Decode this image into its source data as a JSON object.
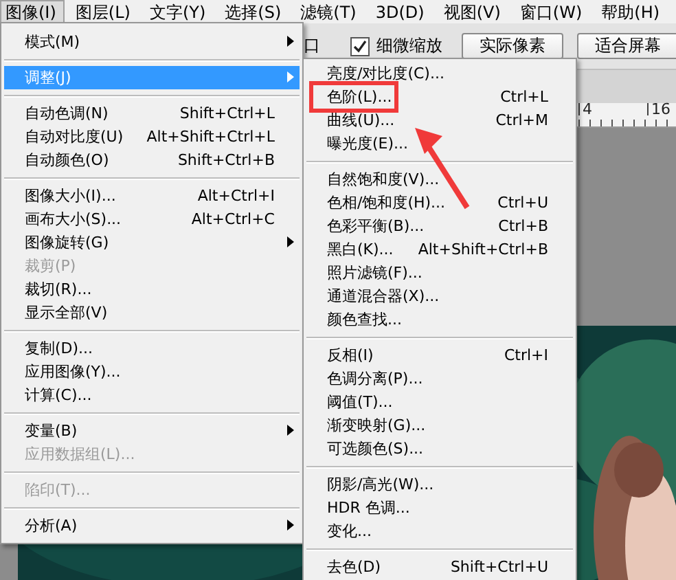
{
  "menu_bar": [
    {
      "label": "图像(I)",
      "selected": true
    },
    {
      "label": "图层(L)",
      "selected": false
    },
    {
      "label": "文字(Y)",
      "selected": false
    },
    {
      "label": "选择(S)",
      "selected": false
    },
    {
      "label": "滤镜(T)",
      "selected": false
    },
    {
      "label": "3D(D)",
      "selected": false
    },
    {
      "label": "视图(V)",
      "selected": false
    },
    {
      "label": "窗口(W)",
      "selected": false
    },
    {
      "label": "帮助(H)",
      "selected": false
    }
  ],
  "options_bar": {
    "cut_label": "口",
    "checkbox": {
      "label": "细微缩放",
      "checked": true
    },
    "buttons": [
      "实际像素",
      "适合屏幕"
    ]
  },
  "ruler": [
    "4",
    "16"
  ],
  "image_menu": {
    "items": [
      {
        "kind": "submenu",
        "label": "模式(M)",
        "selected": false,
        "disabled": false
      },
      {
        "kind": "separator"
      },
      {
        "kind": "submenu",
        "label": "调整(J)",
        "selected": true,
        "disabled": false
      },
      {
        "kind": "separator"
      },
      {
        "kind": "item",
        "label": "自动色调(N)",
        "shortcut": "Shift+Ctrl+L",
        "selected": false,
        "disabled": false
      },
      {
        "kind": "item",
        "label": "自动对比度(U)",
        "shortcut": "Alt+Shift+Ctrl+L",
        "selected": false,
        "disabled": false
      },
      {
        "kind": "item",
        "label": "自动颜色(O)",
        "shortcut": "Shift+Ctrl+B",
        "selected": false,
        "disabled": false
      },
      {
        "kind": "separator"
      },
      {
        "kind": "item",
        "label": "图像大小(I)...",
        "shortcut": "Alt+Ctrl+I",
        "selected": false,
        "disabled": false
      },
      {
        "kind": "item",
        "label": "画布大小(S)...",
        "shortcut": "Alt+Ctrl+C",
        "selected": false,
        "disabled": false
      },
      {
        "kind": "submenu",
        "label": "图像旋转(G)",
        "selected": false,
        "disabled": false
      },
      {
        "kind": "item",
        "label": "裁剪(P)",
        "selected": false,
        "disabled": true
      },
      {
        "kind": "item",
        "label": "裁切(R)...",
        "selected": false,
        "disabled": false
      },
      {
        "kind": "item",
        "label": "显示全部(V)",
        "selected": false,
        "disabled": false
      },
      {
        "kind": "separator"
      },
      {
        "kind": "item",
        "label": "复制(D)...",
        "selected": false,
        "disabled": false
      },
      {
        "kind": "item",
        "label": "应用图像(Y)...",
        "selected": false,
        "disabled": false
      },
      {
        "kind": "item",
        "label": "计算(C)...",
        "selected": false,
        "disabled": false
      },
      {
        "kind": "separator"
      },
      {
        "kind": "submenu",
        "label": "变量(B)",
        "selected": false,
        "disabled": false
      },
      {
        "kind": "item",
        "label": "应用数据组(L)...",
        "selected": false,
        "disabled": true
      },
      {
        "kind": "separator"
      },
      {
        "kind": "item",
        "label": "陷印(T)...",
        "selected": false,
        "disabled": true
      },
      {
        "kind": "separator"
      },
      {
        "kind": "submenu",
        "label": "分析(A)",
        "selected": false,
        "disabled": false
      }
    ]
  },
  "adjust_submenu": {
    "items": [
      {
        "kind": "item",
        "label": "亮度/对比度(C)...",
        "selected": false,
        "highlighted": false
      },
      {
        "kind": "item",
        "label": "色阶(L)...",
        "shortcut": "Ctrl+L",
        "selected": false,
        "highlighted": true
      },
      {
        "kind": "item",
        "label": "曲线(U)...",
        "shortcut": "Ctrl+M",
        "selected": false,
        "highlighted": false
      },
      {
        "kind": "item",
        "label": "曝光度(E)...",
        "selected": false,
        "highlighted": false
      },
      {
        "kind": "separator"
      },
      {
        "kind": "item",
        "label": "自然饱和度(V)...",
        "selected": false,
        "highlighted": false
      },
      {
        "kind": "item",
        "label": "色相/饱和度(H)...",
        "shortcut": "Ctrl+U",
        "selected": false,
        "highlighted": false
      },
      {
        "kind": "item",
        "label": "色彩平衡(B)...",
        "shortcut": "Ctrl+B",
        "selected": false,
        "highlighted": false
      },
      {
        "kind": "item",
        "label": "黑白(K)...",
        "shortcut": "Alt+Shift+Ctrl+B",
        "selected": false,
        "highlighted": false
      },
      {
        "kind": "item",
        "label": "照片滤镜(F)...",
        "selected": false,
        "highlighted": false
      },
      {
        "kind": "item",
        "label": "通道混合器(X)...",
        "selected": false,
        "highlighted": false
      },
      {
        "kind": "item",
        "label": "颜色查找...",
        "selected": false,
        "highlighted": false
      },
      {
        "kind": "separator"
      },
      {
        "kind": "item",
        "label": "反相(I)",
        "shortcut": "Ctrl+I",
        "selected": false,
        "highlighted": false
      },
      {
        "kind": "item",
        "label": "色调分离(P)...",
        "selected": false,
        "highlighted": false
      },
      {
        "kind": "item",
        "label": "阈值(T)...",
        "selected": false,
        "highlighted": false
      },
      {
        "kind": "item",
        "label": "渐变映射(G)...",
        "selected": false,
        "highlighted": false
      },
      {
        "kind": "item",
        "label": "可选颜色(S)...",
        "selected": false,
        "highlighted": false
      },
      {
        "kind": "separator"
      },
      {
        "kind": "item",
        "label": "阴影/高光(W)...",
        "selected": false,
        "highlighted": false
      },
      {
        "kind": "item",
        "label": "HDR 色调...",
        "selected": false,
        "highlighted": false
      },
      {
        "kind": "item",
        "label": "变化...",
        "selected": false,
        "highlighted": false
      },
      {
        "kind": "separator"
      },
      {
        "kind": "item",
        "label": "去色(D)",
        "shortcut": "Shift+Ctrl+U",
        "selected": false,
        "highlighted": false
      }
    ]
  }
}
